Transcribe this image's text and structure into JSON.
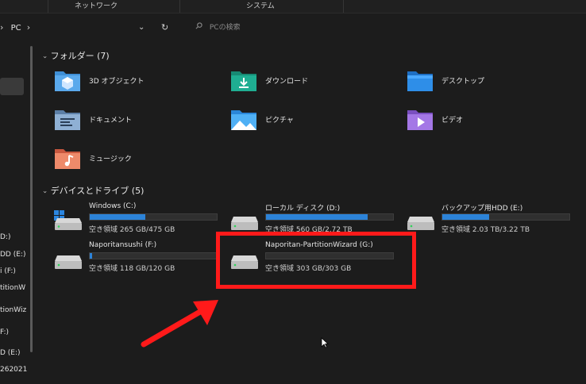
{
  "ribbon": {
    "tabs": [
      "ネットワーク",
      "システム"
    ]
  },
  "address": {
    "path": "PC",
    "search_placeholder": "PCの検索"
  },
  "nav": {
    "items": [
      "D:)",
      "DD (E:)",
      "i (F:)",
      "titionW",
      "tionWiz",
      "F:)",
      "D (E:)",
      "262021"
    ]
  },
  "folders_section": {
    "title": "フォルダー (7)",
    "items": [
      {
        "label": "3D オブジェクト",
        "icon": "3d-objects-folder-icon"
      },
      {
        "label": "ダウンロード",
        "icon": "downloads-folder-icon"
      },
      {
        "label": "デスクトップ",
        "icon": "desktop-folder-icon"
      },
      {
        "label": "ドキュメント",
        "icon": "documents-folder-icon"
      },
      {
        "label": "ピクチャ",
        "icon": "pictures-folder-icon"
      },
      {
        "label": "ビデオ",
        "icon": "videos-folder-icon"
      },
      {
        "label": "ミュージック",
        "icon": "music-folder-icon"
      }
    ]
  },
  "drives_section": {
    "title": "デバイスとドライブ (5)",
    "items": [
      {
        "name": "Windows (C:)",
        "free": "空き領域 265 GB/475 GB",
        "used_fraction": 0.44,
        "icon": "windows-drive-icon"
      },
      {
        "name": "ローカル ディスク (D:)",
        "free": "空き領域 560 GB/2.72 TB",
        "used_fraction": 0.8,
        "icon": "hdd-icon"
      },
      {
        "name": "バックアップ用HDD (E:)",
        "free": "空き領域 2.03 TB/3.22 TB",
        "used_fraction": 0.37,
        "icon": "hdd-icon"
      },
      {
        "name": "Naporitansushi (F:)",
        "free": "空き領域 118 GB/120 GB",
        "used_fraction": 0.02,
        "icon": "hdd-icon"
      },
      {
        "name": "Naporitan-PartitionWizard (G:)",
        "free": "空き領域 303 GB/303 GB",
        "used_fraction": 0.0,
        "icon": "hdd-icon"
      }
    ]
  },
  "colors": {
    "highlight": "#ff1a1a",
    "usage_bar": "#2c83d8"
  }
}
